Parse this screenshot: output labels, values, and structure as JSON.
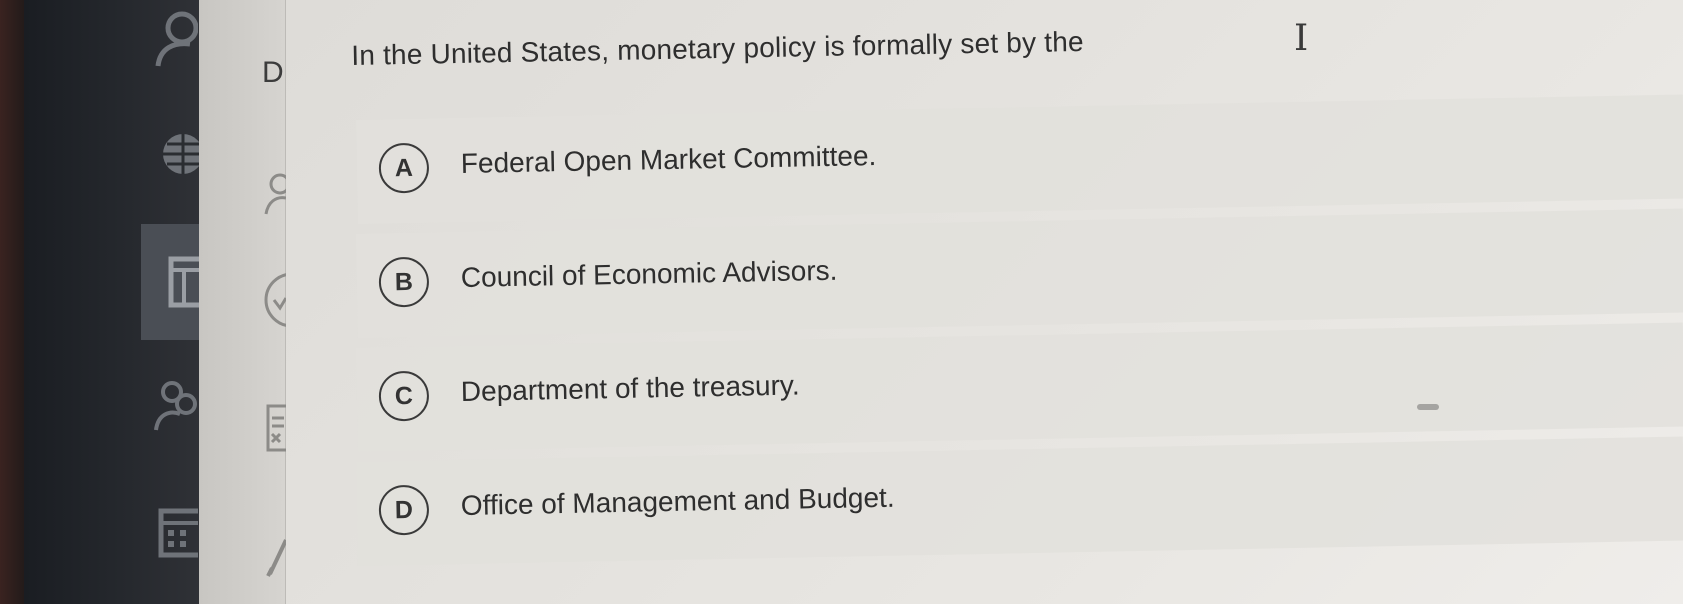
{
  "question": {
    "text": "In the United States, monetary policy is formally set by the"
  },
  "options": [
    {
      "letter": "A",
      "text": "Federal Open Market Committee."
    },
    {
      "letter": "B",
      "text": "Council of Economic Advisors."
    },
    {
      "letter": "C",
      "text": "Department of the treasury."
    },
    {
      "letter": "D",
      "text": "Office of Management and Budget."
    }
  ],
  "side_panel": {
    "letter": "D"
  },
  "left_rail": {
    "icons": [
      "user-icon",
      "globe-icon",
      "layout-icon",
      "people-icon",
      "calendar-icon"
    ],
    "selected": "layout-icon"
  },
  "side_panel_icons": [
    "user-icon",
    "check-circle-icon",
    "spreadsheet-icon",
    "pencil-icon"
  ],
  "colors": {
    "text": "#2e2e2e",
    "content_bg": "#e4e2de",
    "rail_bg": "#25282d",
    "rail_selected_bg": "#4a4e55"
  }
}
